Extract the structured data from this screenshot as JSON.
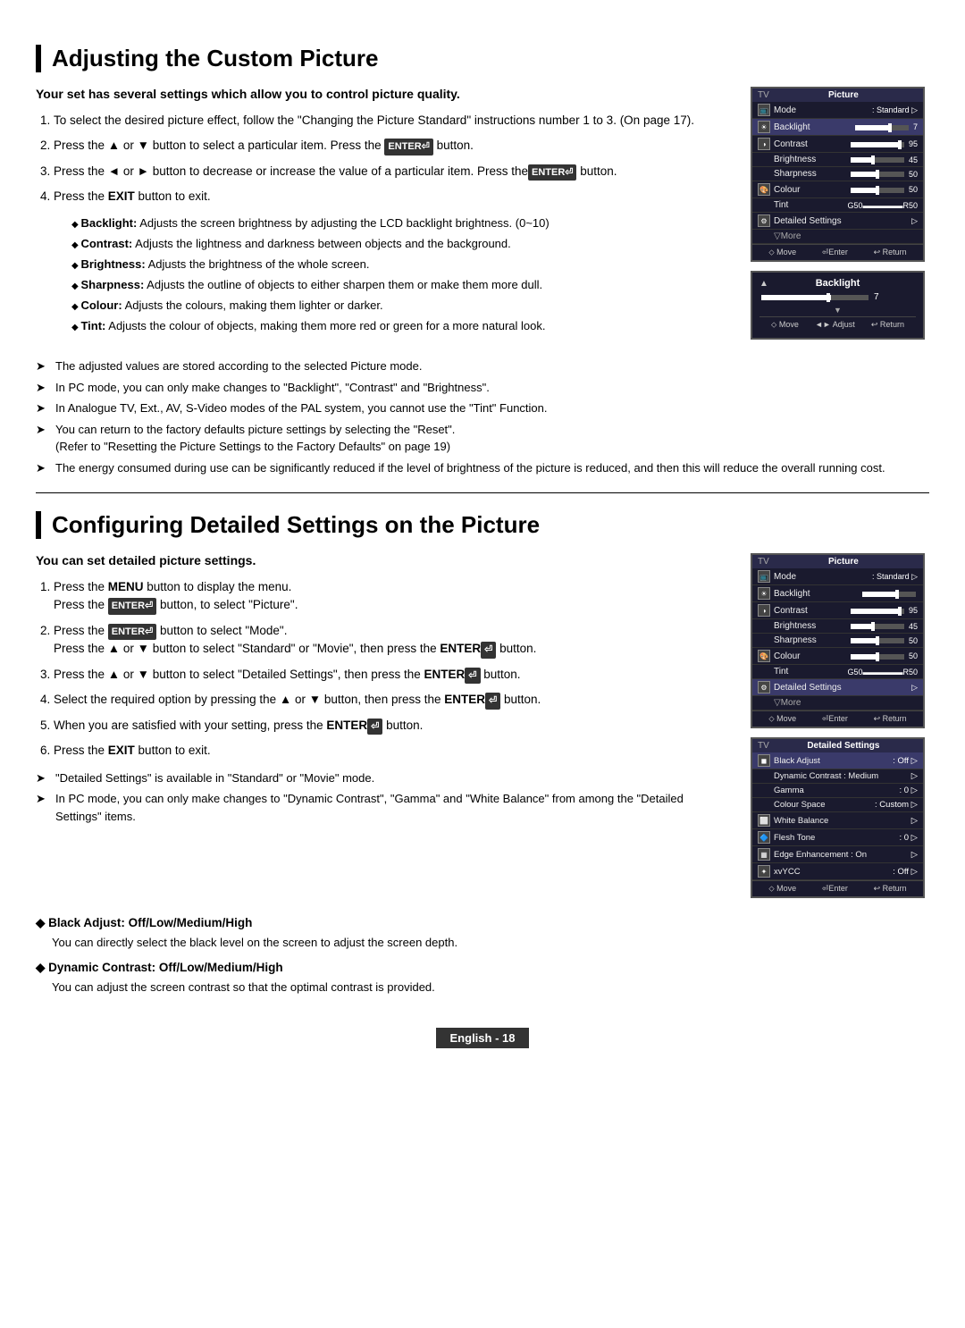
{
  "section1": {
    "title": "Adjusting the Custom Picture",
    "intro": "Your set has several settings which allow you to control picture quality.",
    "steps": [
      "To select the desired picture effect, follow the \"Changing the Picture Standard\" instructions number 1 to 3. (On page 17).",
      "Press the ▲ or ▼ button to select a particular item. Press the ENTER⏎ button.",
      "Press the ◄ or ► button to decrease or increase the value of a particular item. Press theENTER⏎ button.",
      "Press the EXIT button to exit."
    ],
    "bullets": [
      "<b>Backlight:</b> Adjusts the screen brightness by adjusting the LCD backlight brightness. (0~10)",
      "<b>Contrast:</b> Adjusts the lightness and darkness between objects and the background.",
      "<b>Brightness:</b> Adjusts the brightness of the whole screen.",
      "<b>Sharpness:</b> Adjusts the outline of objects to either sharpen them or make them more dull.",
      "<b>Colour:</b> Adjusts the colours, making them lighter or darker.",
      "<b>Tint:</b> Adjusts the colour of objects, making them more red or green for a more natural look."
    ],
    "notes": [
      "The adjusted values are stored according to the selected Picture mode.",
      "In PC mode, you can only make changes to \"Backlight\", \"Contrast\" and \"Brightness\".",
      "In Analogue TV, Ext., AV, S-Video modes of the PAL system, you cannot use the \"Tint\" Function.",
      "You can return to the factory defaults picture settings by selecting the \"Reset\".\n(Refer to \"Resetting the Picture Settings to the Factory Defaults\" on page 19)",
      "The energy consumed during use can be significantly reduced if the level of brightness of the picture is reduced, and then this will reduce the overall running cost."
    ],
    "tv1": {
      "label": "TV",
      "menu": "Picture",
      "rows": [
        {
          "icon": true,
          "label": "Mode",
          "value": ": Standard",
          "arrow": true,
          "slider": false,
          "sliderPos": 0,
          "selected": false
        },
        {
          "icon": true,
          "label": "Backlight",
          "value": "7",
          "arrow": false,
          "slider": true,
          "sliderPos": 65,
          "selected": true
        },
        {
          "icon": true,
          "label": "Contrast",
          "value": "95",
          "arrow": false,
          "slider": true,
          "sliderPos": 92,
          "selected": false
        },
        {
          "icon": false,
          "label": "Brightness",
          "value": "45",
          "arrow": false,
          "slider": true,
          "sliderPos": 42,
          "selected": false
        },
        {
          "icon": false,
          "label": "Sharpness",
          "value": "50",
          "arrow": false,
          "slider": true,
          "sliderPos": 50,
          "selected": false
        },
        {
          "icon": true,
          "label": "Colour",
          "value": "50",
          "arrow": false,
          "slider": true,
          "sliderPos": 50,
          "selected": false
        },
        {
          "icon": false,
          "label": "Tint",
          "value": "",
          "arrow": false,
          "slider": false,
          "tintBar": true,
          "selected": false
        },
        {
          "icon": true,
          "label": "Detailed Settings",
          "value": "",
          "arrow": true,
          "slider": false,
          "selected": false
        },
        {
          "icon": false,
          "label": "▽More",
          "value": "",
          "arrow": false,
          "slider": false,
          "selected": false
        }
      ],
      "nav": [
        "⬦ Move",
        "⏎Enter",
        "↩ Return"
      ]
    },
    "tv2": {
      "label": "Backlight",
      "value": "7",
      "nav": [
        "⬦ Move",
        "◄► Adjust",
        "↩ Return"
      ]
    }
  },
  "section2": {
    "title": "Configuring Detailed Settings on the Picture",
    "intro": "You can set detailed picture settings.",
    "steps": [
      "Press the MENU button to display the menu.\nPress the ENTER⏎ button, to select \"Picture\".",
      "Press the ENTER⏎ button to select \"Mode\".\nPress the ▲ or ▼ button to select \"Standard\" or \"Movie\", then press the ENTER⏎ button.",
      "Press the ▲ or ▼ button to select \"Detailed Settings\", then press the ENTER⏎ button.",
      "Select the required option by pressing the ▲ or ▼ button, then press the ENTER⏎ button.",
      "When you are satisfied with your setting, press the ENTER⏎ button.",
      "Press the EXIT button to exit."
    ],
    "notes": [
      "\"Detailed Settings\" is available in \"Standard\" or \"Movie\" mode.",
      "In PC mode, you can only make changes to \"Dynamic Contrast\", \"Gamma\" and \"White Balance\" from among the \"Detailed Settings\" items."
    ],
    "tv3": {
      "label": "TV",
      "menu": "Picture",
      "rows": [
        {
          "icon": true,
          "label": "Mode",
          "value": ": Standard",
          "arrow": true,
          "slider": false,
          "sliderPos": 0,
          "selected": false
        },
        {
          "icon": true,
          "label": "Backlight",
          "value": "",
          "arrow": false,
          "slider": true,
          "sliderPos": 65,
          "selected": false
        },
        {
          "icon": true,
          "label": "Contrast",
          "value": "95",
          "arrow": false,
          "slider": true,
          "sliderPos": 92,
          "selected": false
        },
        {
          "icon": false,
          "label": "Brightness",
          "value": "45",
          "arrow": false,
          "slider": true,
          "sliderPos": 42,
          "selected": false
        },
        {
          "icon": false,
          "label": "Sharpness",
          "value": "50",
          "arrow": false,
          "slider": true,
          "sliderPos": 50,
          "selected": false
        },
        {
          "icon": true,
          "label": "Colour",
          "value": "50",
          "arrow": false,
          "slider": true,
          "sliderPos": 50,
          "selected": false
        },
        {
          "icon": false,
          "label": "Tint",
          "value": "",
          "arrow": false,
          "slider": false,
          "tintBar": true,
          "selected": false
        },
        {
          "icon": true,
          "label": "Detailed Settings",
          "value": "",
          "arrow": true,
          "slider": false,
          "selected": true
        },
        {
          "icon": false,
          "label": "▽More",
          "value": "",
          "arrow": false,
          "slider": false,
          "selected": false
        }
      ],
      "nav": [
        "⬦ Move",
        "⏎Enter",
        "↩ Return"
      ]
    },
    "tv4": {
      "label": "TV",
      "menu": "Detailed Settings",
      "rows": [
        {
          "label": "Black Adjust",
          "value": ": Off",
          "arrow": true
        },
        {
          "label": "Dynamic Contrast",
          "value": ": Medium",
          "arrow": true
        },
        {
          "label": "Gamma",
          "value": ": 0",
          "arrow": true
        },
        {
          "label": "Colour Space",
          "value": ": Custom",
          "arrow": true
        },
        {
          "label": "White Balance",
          "value": "",
          "arrow": true
        },
        {
          "label": "Flesh Tone",
          "value": ": 0",
          "arrow": true
        },
        {
          "label": "Edge Enhancement : On",
          "value": "",
          "arrow": true
        },
        {
          "label": "xvYCC",
          "value": ": Off",
          "arrow": true
        }
      ],
      "nav": [
        "⬦ Move",
        "⏎Enter",
        "↩ Return"
      ]
    }
  },
  "subsections": [
    {
      "title": "Black Adjust: Off/Low/Medium/High",
      "text": "You can directly select the black level on the screen to adjust the screen depth."
    },
    {
      "title": "Dynamic Contrast: Off/Low/Medium/High",
      "text": "You can adjust the screen contrast so that the optimal contrast is provided."
    }
  ],
  "footer": {
    "label": "English - 18"
  }
}
